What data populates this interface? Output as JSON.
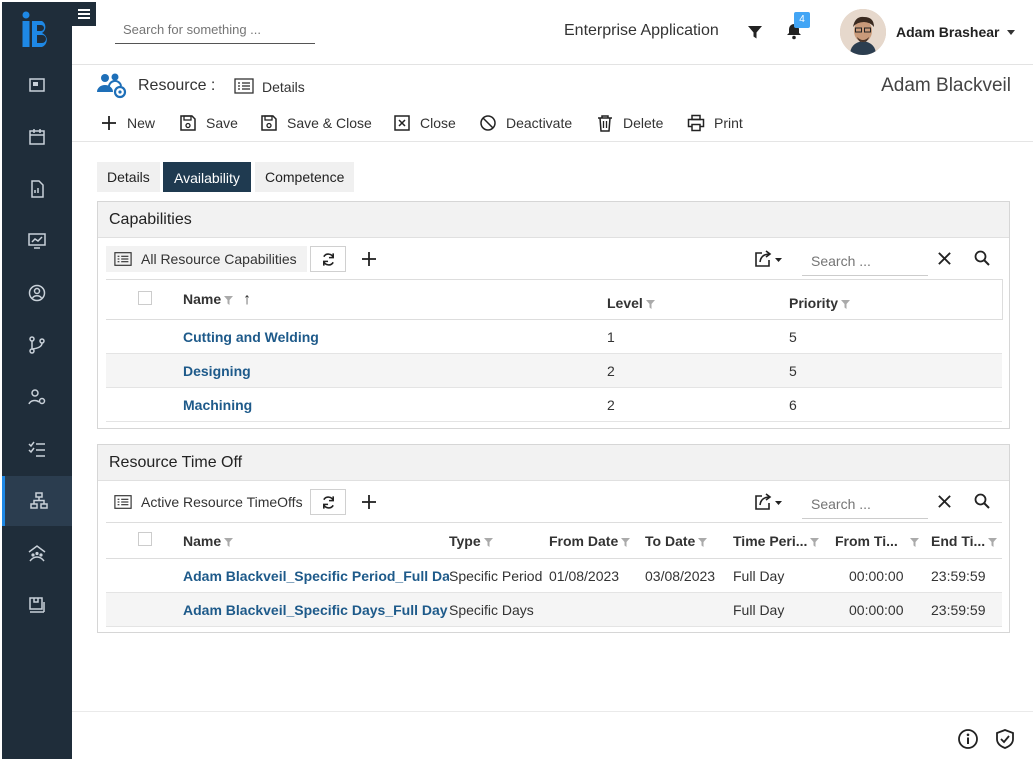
{
  "header": {
    "search_placeholder": "Search for something ...",
    "app_name": "Enterprise Application",
    "notification_count": "4",
    "user_name": "Adam Brashear"
  },
  "subheader": {
    "entity_label": "Resource :",
    "view_label": "Details",
    "record_name": "Adam Blackveil"
  },
  "toolbar": {
    "new": "New",
    "save": "Save",
    "save_close": "Save & Close",
    "close": "Close",
    "deactivate": "Deactivate",
    "delete": "Delete",
    "print": "Print"
  },
  "tabs": [
    "Details",
    "Availability",
    "Competence"
  ],
  "active_tab": "Availability",
  "capabilities": {
    "title": "Capabilities",
    "view_name": "All Resource Capabilities",
    "search_placeholder": "Search ...",
    "columns": [
      "Name",
      "Level",
      "Priority"
    ],
    "sort_indicator": "↑",
    "rows": [
      {
        "name": "Cutting and Welding",
        "level": "1",
        "priority": "5"
      },
      {
        "name": "Designing",
        "level": "2",
        "priority": "5"
      },
      {
        "name": "Machining",
        "level": "2",
        "priority": "6"
      }
    ]
  },
  "timeoff": {
    "title": "Resource Time Off",
    "view_name": "Active Resource TimeOffs",
    "search_placeholder": "Search ...",
    "columns": [
      "Name",
      "Type",
      "From Date",
      "To Date",
      "Time Peri...",
      "From Ti...",
      "End Ti..."
    ],
    "rows": [
      {
        "name": "Adam Blackveil_Specific Period_Full Day",
        "type": "Specific Period",
        "from_date": "01/08/2023",
        "to_date": "03/08/2023",
        "period": "Full Day",
        "from_time": "00:00:00",
        "end_time": "23:59:59"
      },
      {
        "name": "Adam Blackveil_Specific Days_Full Day",
        "type": "Specific Days",
        "from_date": "",
        "to_date": "",
        "period": "Full Day",
        "from_time": "00:00:00",
        "end_time": "23:59:59"
      }
    ]
  },
  "colors": {
    "sidebar": "#1f2d3a",
    "accent": "#1e88e5",
    "active_tab": "#1f3a50",
    "link": "#1e5a8a"
  }
}
